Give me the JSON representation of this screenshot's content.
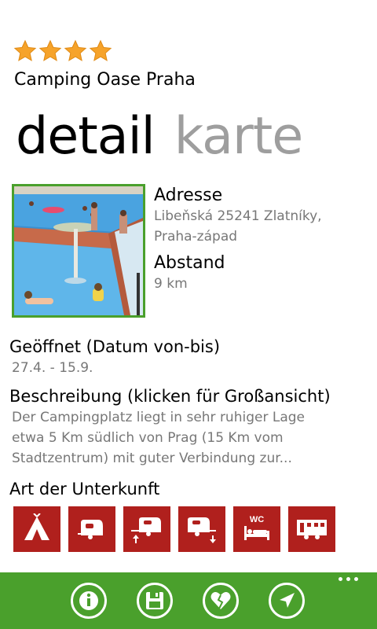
{
  "rating": {
    "stars": 4,
    "max": 4,
    "star_color": "#f6a32a"
  },
  "header": {
    "title": "Camping Oase Praha"
  },
  "pivot": {
    "tabs": [
      {
        "label": "detail",
        "active": true
      },
      {
        "label": "karte",
        "active": false
      }
    ]
  },
  "details": {
    "address_label": "Adresse",
    "address_line1": "Libeňská 25241 Zlatníky,",
    "address_line2": "Praha-západ",
    "distance_label": "Abstand",
    "distance_value": "9 km"
  },
  "opening": {
    "label": "Geöffnet (Datum von-bis)",
    "value": "27.4. - 15.9."
  },
  "description": {
    "label": "Beschreibung (klicken für Großansicht)",
    "line1": "Der Campingplatz liegt in sehr ruhiger Lage",
    "line2": "etwa 5 Km südlich von Prag (15 Km vom",
    "line3": "Stadtzentrum) mit guter Verbindung zur..."
  },
  "accommodation": {
    "label": "Art der Unterkunft",
    "items": [
      {
        "icon": "tent-icon"
      },
      {
        "icon": "caravan-icon"
      },
      {
        "icon": "caravan-arrive-icon"
      },
      {
        "icon": "caravan-depart-icon"
      },
      {
        "icon": "wc-bed-icon",
        "text": "WC"
      },
      {
        "icon": "mobile-home-icon"
      }
    ],
    "tile_color": "#b0201d"
  },
  "appbar": {
    "color": "#4aa02c",
    "buttons": [
      {
        "icon": "info-icon"
      },
      {
        "icon": "save-icon"
      },
      {
        "icon": "broken-heart-icon"
      },
      {
        "icon": "navigate-icon"
      }
    ]
  }
}
